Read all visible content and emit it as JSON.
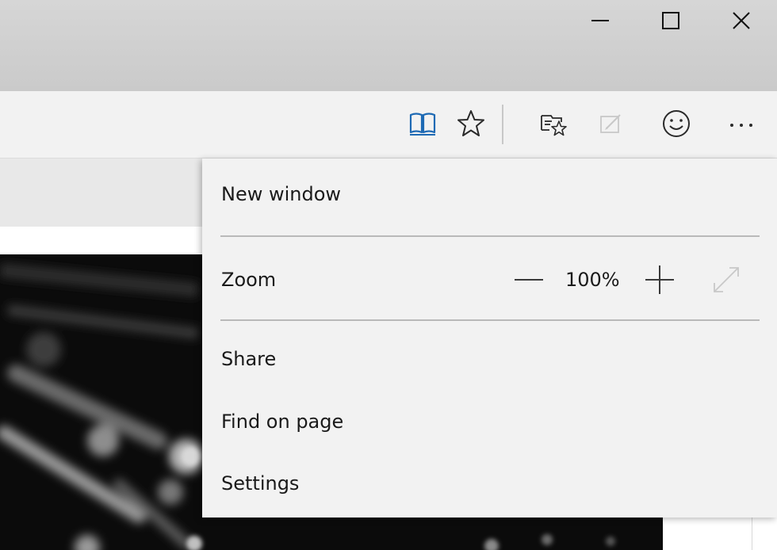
{
  "window_controls": {
    "minimize": "minimize-icon",
    "maximize": "maximize-icon",
    "close": "close-icon"
  },
  "toolbar": {
    "icons": [
      {
        "name": "reading-view-icon",
        "state": "active",
        "color": "#1e6ab4"
      },
      {
        "name": "favorite-star-icon"
      },
      {
        "name": "hub-icon"
      },
      {
        "name": "web-note-icon",
        "state": "disabled"
      },
      {
        "name": "feedback-smiley-icon"
      },
      {
        "name": "more-actions-icon"
      }
    ]
  },
  "menu": {
    "new_window": "New window",
    "zoom_label": "Zoom",
    "zoom_value": "100%",
    "share": "Share",
    "find_on_page": "Find on page",
    "settings": "Settings"
  },
  "colors": {
    "titlebar": "#d3d3d3",
    "toolbar": "#f2f2f2",
    "menu_bg": "#f2f2f2",
    "accent": "#1e6ab4",
    "text": "#1a1a1a",
    "disabled": "#c8c8c8"
  }
}
